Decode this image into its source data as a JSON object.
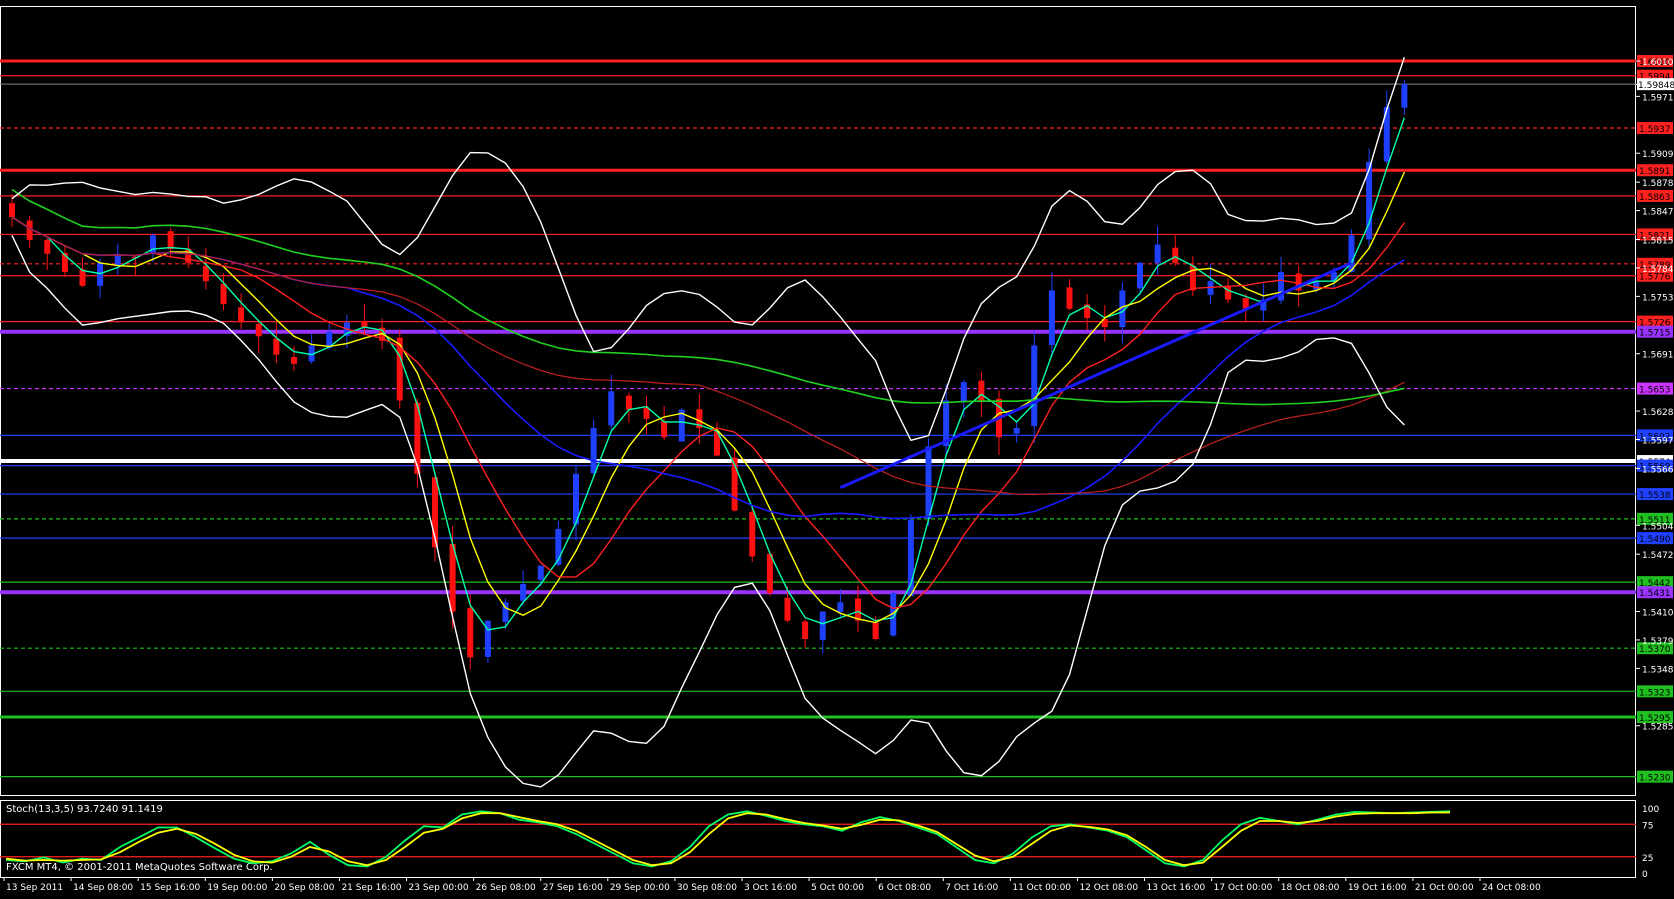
{
  "chart_data": [
    {
      "type": "candlestick",
      "ylim": [
        1.521,
        1.607
      ],
      "price_labels": [
        "1.60100",
        "1.59845",
        "1.59715",
        "1.59095",
        "1.58780",
        "1.58470",
        "1.58155",
        "1.57845",
        "1.57535",
        "1.56910",
        "1.56285",
        "1.55975",
        "1.55660",
        "1.55040",
        "1.54725",
        "1.54100",
        "1.53790",
        "1.53480",
        "1.52855"
      ],
      "x_labels": [
        "13 Sep 2011",
        "14 Sep 08:00",
        "15 Sep 16:00",
        "19 Sep 00:00",
        "20 Sep 08:00",
        "21 Sep 16:00",
        "23 Sep 00:00",
        "26 Sep 08:00",
        "27 Sep 16:00",
        "29 Sep 00:00",
        "30 Sep 08:00",
        "3 Oct 16:00",
        "5 Oct 00:00",
        "6 Oct 08:00",
        "7 Oct 16:00",
        "11 Oct 00:00",
        "12 Oct 08:00",
        "13 Oct 16:00",
        "17 Oct 00:00",
        "18 Oct 08:00",
        "19 Oct 16:00",
        "21 Oct 00:00",
        "24 Oct 08:00"
      ],
      "close_series": [
        1.584,
        1.5815,
        1.58,
        1.578,
        1.5765,
        1.579,
        1.58,
        1.5795,
        1.582,
        1.5805,
        1.579,
        1.577,
        1.5745,
        1.5725,
        1.571,
        1.569,
        1.568,
        1.57,
        1.5715,
        1.5725,
        1.572,
        1.5705,
        1.564,
        1.556,
        1.548,
        1.541,
        1.536,
        1.54,
        1.542,
        1.544,
        1.546,
        1.55,
        1.556,
        1.561,
        1.565,
        1.563,
        1.562,
        1.56,
        1.563,
        1.561,
        1.558,
        1.552,
        1.547,
        1.543,
        1.54,
        1.538,
        1.541,
        1.542,
        1.54,
        1.538,
        1.543,
        1.551,
        1.559,
        1.564,
        1.566,
        1.564,
        1.56,
        1.561,
        1.57,
        1.576,
        1.574,
        1.573,
        1.572,
        1.576,
        1.579,
        1.581,
        1.579,
        1.576,
        1.577,
        1.575,
        1.574,
        1.575,
        1.578,
        1.576,
        1.577,
        1.578,
        1.582,
        1.59,
        1.596,
        1.5985
      ],
      "horizontal_levels": [
        {
          "label": "1.6010",
          "color": "#ff2020",
          "style": "solid"
        },
        {
          "label": "1.5994",
          "color": "#ff2020",
          "style": "solid"
        },
        {
          "label": "1.5937",
          "color": "#ff2020",
          "style": "dashed"
        },
        {
          "label": "1.5891",
          "color": "#ff2020",
          "style": "solid"
        },
        {
          "label": "1.5863",
          "color": "#ff2020",
          "style": "solid"
        },
        {
          "label": "1.5821",
          "color": "#ff2020",
          "style": "solid"
        },
        {
          "label": "1.5789",
          "color": "#ff2020",
          "style": "dashed"
        },
        {
          "label": "1.5776",
          "color": "#ff2020",
          "style": "solid"
        },
        {
          "label": "1.5726",
          "color": "#ff2020",
          "style": "solid"
        },
        {
          "label": "1.5715",
          "color": "#9933ff",
          "style": "solid"
        },
        {
          "label": "1.5653",
          "color": "#cc33ff",
          "style": "dashed"
        },
        {
          "label": "1.5602",
          "color": "#2040ff",
          "style": "solid"
        },
        {
          "label": "1.5574",
          "color": "#ffffff",
          "style": "solid"
        },
        {
          "label": "1.5569",
          "color": "#2040ff",
          "style": "solid"
        },
        {
          "label": "1.5538",
          "color": "#2040ff",
          "style": "solid"
        },
        {
          "label": "1.5511",
          "color": "#20c020",
          "style": "dashed"
        },
        {
          "label": "1.5490",
          "color": "#2040ff",
          "style": "solid"
        },
        {
          "label": "1.5442",
          "color": "#20c020",
          "style": "solid"
        },
        {
          "label": "1.5431",
          "color": "#9933ff",
          "style": "solid"
        },
        {
          "label": "1.5370",
          "color": "#20c020",
          "style": "dashed"
        },
        {
          "label": "1.5323",
          "color": "#20c020",
          "style": "solid"
        },
        {
          "label": "1.5295",
          "color": "#20c020",
          "style": "solid"
        },
        {
          "label": "1.5230",
          "color": "#20c020",
          "style": "solid"
        }
      ],
      "current_price": "1.59848",
      "colors": {
        "bull": "#2040ff",
        "bear": "#ff1010",
        "bollinger": "#ffffff",
        "ma_fast": "#00ffaa",
        "ma_mid": "#ffff00",
        "ma_slow": "#ff2020",
        "ma_blue": "#1a1aff",
        "ma_green": "#20d020",
        "ma_dark_red": "#c02020"
      },
      "watermark": "FXCM MT4, © 2001-2011 MetaQuotes Software Corp."
    },
    {
      "type": "line",
      "title": "Stoch(13,3,5) 93.7240 91.1419",
      "ylim": [
        0,
        100
      ],
      "y_labels": [
        "100",
        "75",
        "25",
        "0"
      ],
      "levels": [
        75,
        25
      ],
      "series": [
        {
          "color": "#00ff66",
          "values": [
            20,
            18,
            24,
            16,
            22,
            20,
            40,
            55,
            70,
            70,
            55,
            38,
            22,
            15,
            18,
            30,
            48,
            28,
            12,
            10,
            25,
            50,
            72,
            70,
            90,
            95,
            92,
            82,
            78,
            72,
            60,
            45,
            30,
            15,
            10,
            18,
            40,
            72,
            90,
            95,
            88,
            80,
            75,
            72,
            65,
            78,
            86,
            80,
            70,
            60,
            40,
            20,
            15,
            30,
            55,
            72,
            75,
            70,
            65,
            55,
            35,
            15,
            10,
            20,
            50,
            75,
            85,
            80,
            75,
            82,
            90,
            94,
            93,
            92,
            93,
            94,
            95
          ]
        },
        {
          "color": "#ffff00",
          "values": [
            22,
            19,
            20,
            19,
            20,
            21,
            32,
            48,
            62,
            68,
            60,
            45,
            28,
            18,
            16,
            25,
            40,
            33,
            18,
            12,
            20,
            40,
            62,
            68,
            84,
            92,
            92,
            86,
            80,
            75,
            65,
            50,
            35,
            20,
            12,
            15,
            32,
            60,
            84,
            92,
            90,
            83,
            77,
            73,
            68,
            74,
            82,
            81,
            73,
            63,
            45,
            27,
            18,
            25,
            45,
            65,
            73,
            71,
            67,
            58,
            40,
            20,
            12,
            16,
            40,
            65,
            80,
            80,
            77,
            80,
            87,
            91,
            92,
            92,
            92,
            93,
            93
          ]
        }
      ]
    }
  ]
}
